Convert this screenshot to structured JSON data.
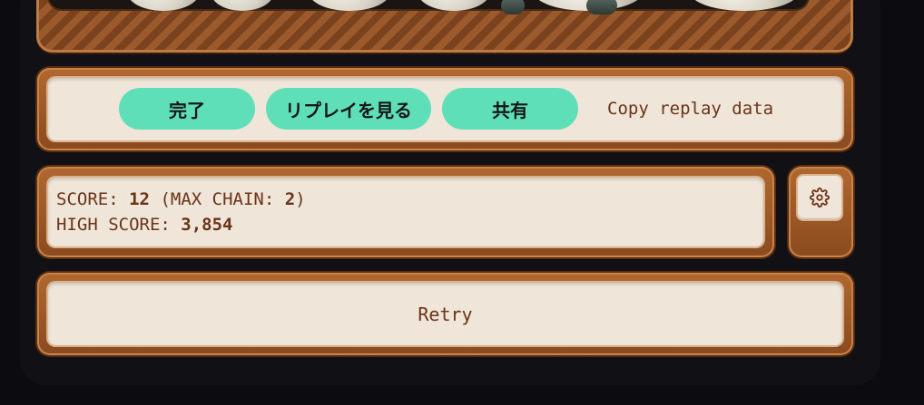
{
  "actions": {
    "done_label": "完了",
    "replay_label": "リプレイを見る",
    "share_label": "共有",
    "copy_replay_label": "Copy replay data"
  },
  "score": {
    "score_label": "SCORE:",
    "score_value": "12",
    "max_chain_label": "(MAX CHAIN:",
    "max_chain_value": "2",
    "max_chain_close": ")",
    "high_score_label": "HIGH SCORE:",
    "high_score_value": "3,854"
  },
  "settings": {
    "icon": "gear-icon"
  },
  "retry": {
    "label": "Retry"
  },
  "colors": {
    "accent": "#5fdfb7",
    "text_brown": "#6a3418",
    "panel_wood": "#9a5a2c",
    "panel_inner": "#efe5d9",
    "background": "#0c0c10"
  }
}
